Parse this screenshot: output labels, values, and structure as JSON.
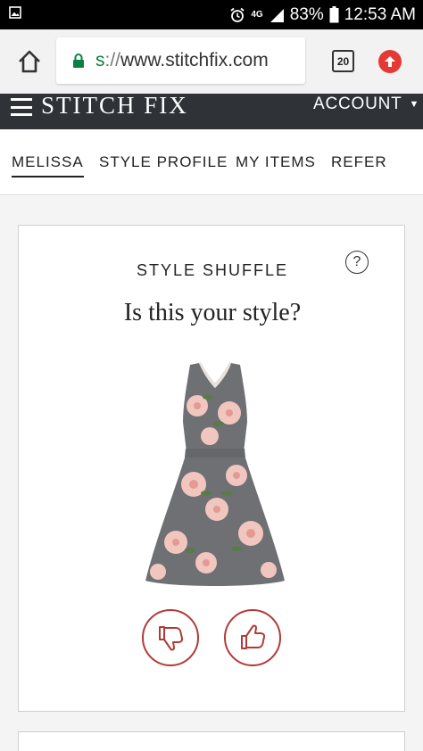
{
  "status_bar": {
    "icons": [
      "image-icon",
      "alarm-icon",
      "lte-icon",
      "signal-icon",
      "battery-icon"
    ],
    "network_label": "4G",
    "battery": "83%",
    "time": "12:53 AM"
  },
  "browser": {
    "url_scheme": "s",
    "url_separator": "://",
    "url_host": "www.stitchfix.com",
    "tab_count": "20",
    "accent": "#0b8043",
    "update_color": "#e53935"
  },
  "header": {
    "brand": "STITCH FIX",
    "account_label": "ACCOUNT",
    "background": "#2f3338"
  },
  "nav": {
    "items": [
      {
        "label": "MELISSA",
        "active": true
      },
      {
        "label": "STYLE PROFILE",
        "active": false
      },
      {
        "label": "MY ITEMS",
        "active": false
      },
      {
        "label": "REFER",
        "active": false
      }
    ]
  },
  "card": {
    "eyebrow": "STYLE SHUFFLE",
    "title": "Is this your style?",
    "help_symbol": "?",
    "vote_color": "#b23a36",
    "dress_colors": {
      "fabric": "#6f7073",
      "flower": "#f1c6bf",
      "leaf": "#5a7a4a"
    }
  }
}
